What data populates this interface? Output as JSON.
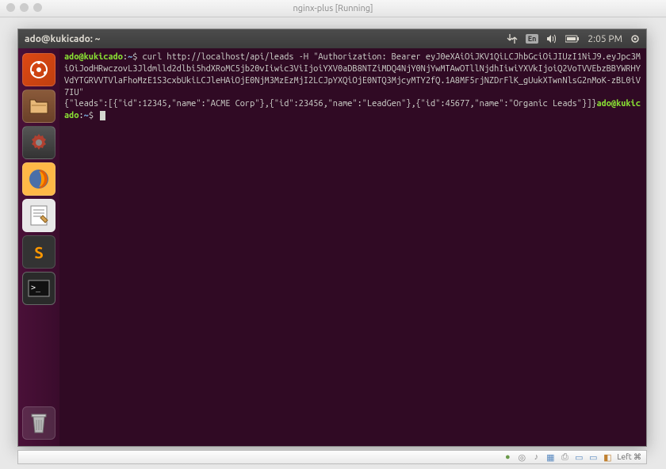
{
  "mac": {
    "window_title": "nginx-plus [Running]",
    "status_right": "Left ⌘"
  },
  "ubuntu": {
    "menubar_title": "ado@kukicado: ~",
    "time": "2:05 PM",
    "lang_badge": "En"
  },
  "launcher": {
    "dash": "dash",
    "files": "files",
    "settings": "settings",
    "firefox": "firefox",
    "gedit": "text-editor",
    "sublime": "sublime",
    "terminal": "terminal",
    "trash": "trash"
  },
  "terminal": {
    "user": "ado@kukicado",
    "path": "~",
    "prompt_sym": "$",
    "cmd": "curl http://localhost/api/leads -H \"Authorization: Bearer eyJ0eXAiOiJKV1QiLCJhbGciOiJIUzI1NiJ9.eyJpc3MiOiJodHRwczovL3Jldmlld2dlbi5hdXRoMC5jb20vIiwic3ViIjoiYXV0aDB8NTZiMDQ4NjY0NjYwMTAwOTllNjdhIiwiYXVkIjoiQ2VoTVVEbzBBYWRHYVdYTGRVVTVlaFhoMzE1S3cxbUkiLCJleHAiOjE0NjM3MzEzMjI2LCJpYXQiOjE0NTQ3MjcyMTY2fQ.1A8MF5rjNZDrFlK_gUukXTwnNlsG2nMoK-zBL0iV7IU\"",
    "output": "{\"leads\":[{\"id\":12345,\"name\":\"ACME Corp\"},{\"id\":23456,\"name\":\"LeadGen\"},{\"id\":45677,\"name\":\"Organic Leads\"}]}",
    "sublime_label": "S"
  }
}
